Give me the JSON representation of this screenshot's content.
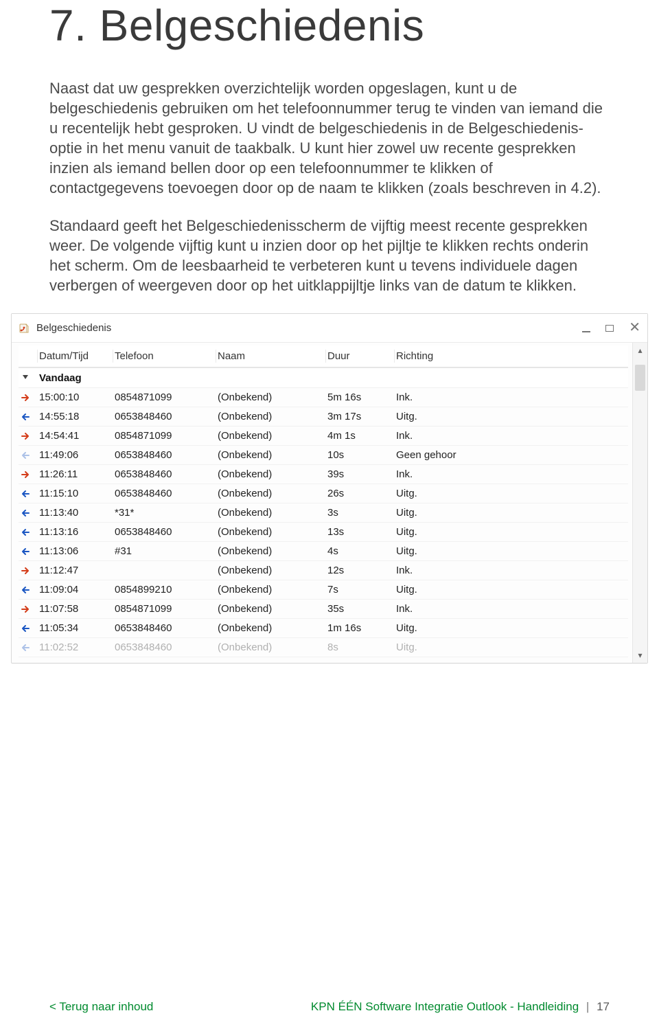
{
  "page": {
    "heading": "7. Belgeschiedenis",
    "para1": "Naast dat uw gesprekken overzichtelijk worden opgeslagen, kunt u de belgeschiedenis gebruiken om het telefoonnummer terug te vinden van iemand die u recentelijk hebt gesproken. U vindt de belgeschiedenis in de Belgeschiedenis-optie in het menu vanuit de taakbalk. U kunt hier zowel uw recente gesprekken inzien als iemand bellen door op een telefoonnummer te klikken of contactgegevens toevoegen door op de naam te klikken (zoals beschreven in 4.2).",
    "para2": "Standaard geeft het Belgeschiedenisscherm de vijftig meest recente gesprekken weer. De volgende vijftig kunt u inzien door op het pijltje te klikken rechts onderin het scherm. Om de leesbaarheid te verbeteren kunt u tevens individuele dagen verbergen of weergeven door op het uitklappijltje links van de datum te klikken."
  },
  "window": {
    "title": "Belgeschiedenis",
    "columns": {
      "datetime": "Datum/Tijd",
      "phone": "Telefoon",
      "name": "Naam",
      "duration": "Duur",
      "direction": "Richting"
    },
    "section_label": "Vandaag",
    "rows": [
      {
        "dir": "in",
        "time": "15:00:10",
        "phone": "0854871099",
        "name": "(Onbekend)",
        "dur": "5m 16s",
        "dirlabel": "Ink."
      },
      {
        "dir": "out",
        "time": "14:55:18",
        "phone": "0653848460",
        "name": "(Onbekend)",
        "dur": "3m 17s",
        "dirlabel": "Uitg."
      },
      {
        "dir": "in",
        "time": "14:54:41",
        "phone": "0854871099",
        "name": "(Onbekend)",
        "dur": "4m 1s",
        "dirlabel": "Ink."
      },
      {
        "dir": "outghost",
        "time": "11:49:06",
        "phone": "0653848460",
        "name": "(Onbekend)",
        "dur": "10s",
        "dirlabel": "Geen gehoor"
      },
      {
        "dir": "in",
        "time": "11:26:11",
        "phone": "0653848460",
        "name": "(Onbekend)",
        "dur": "39s",
        "dirlabel": "Ink."
      },
      {
        "dir": "out",
        "time": "11:15:10",
        "phone": "0653848460",
        "name": "(Onbekend)",
        "dur": "26s",
        "dirlabel": "Uitg."
      },
      {
        "dir": "out",
        "time": "11:13:40",
        "phone": "*31*",
        "name": "(Onbekend)",
        "dur": "3s",
        "dirlabel": "Uitg."
      },
      {
        "dir": "out",
        "time": "11:13:16",
        "phone": "0653848460",
        "name": "(Onbekend)",
        "dur": "13s",
        "dirlabel": "Uitg."
      },
      {
        "dir": "out",
        "time": "11:13:06",
        "phone": "#31",
        "name": "(Onbekend)",
        "dur": "4s",
        "dirlabel": "Uitg."
      },
      {
        "dir": "in",
        "time": "11:12:47",
        "phone": "",
        "name": "(Onbekend)",
        "dur": "12s",
        "dirlabel": "Ink."
      },
      {
        "dir": "out",
        "time": "11:09:04",
        "phone": "0854899210",
        "name": "(Onbekend)",
        "dur": "7s",
        "dirlabel": "Uitg."
      },
      {
        "dir": "in",
        "time": "11:07:58",
        "phone": "0854871099",
        "name": "(Onbekend)",
        "dur": "35s",
        "dirlabel": "Ink."
      },
      {
        "dir": "out",
        "time": "11:05:34",
        "phone": "0653848460",
        "name": "(Onbekend)",
        "dur": "1m 16s",
        "dirlabel": "Uitg."
      }
    ],
    "faded_row": {
      "dir": "out",
      "time": "11:02:52",
      "phone": "0653848460",
      "name": "(Onbekend)",
      "dur": "8s",
      "dirlabel": "Uitg."
    }
  },
  "footer": {
    "back": "< Terug naar inhoud",
    "doc": "KPN ÉÉN Software Integratie Outlook - Handleiding",
    "page": "17"
  }
}
